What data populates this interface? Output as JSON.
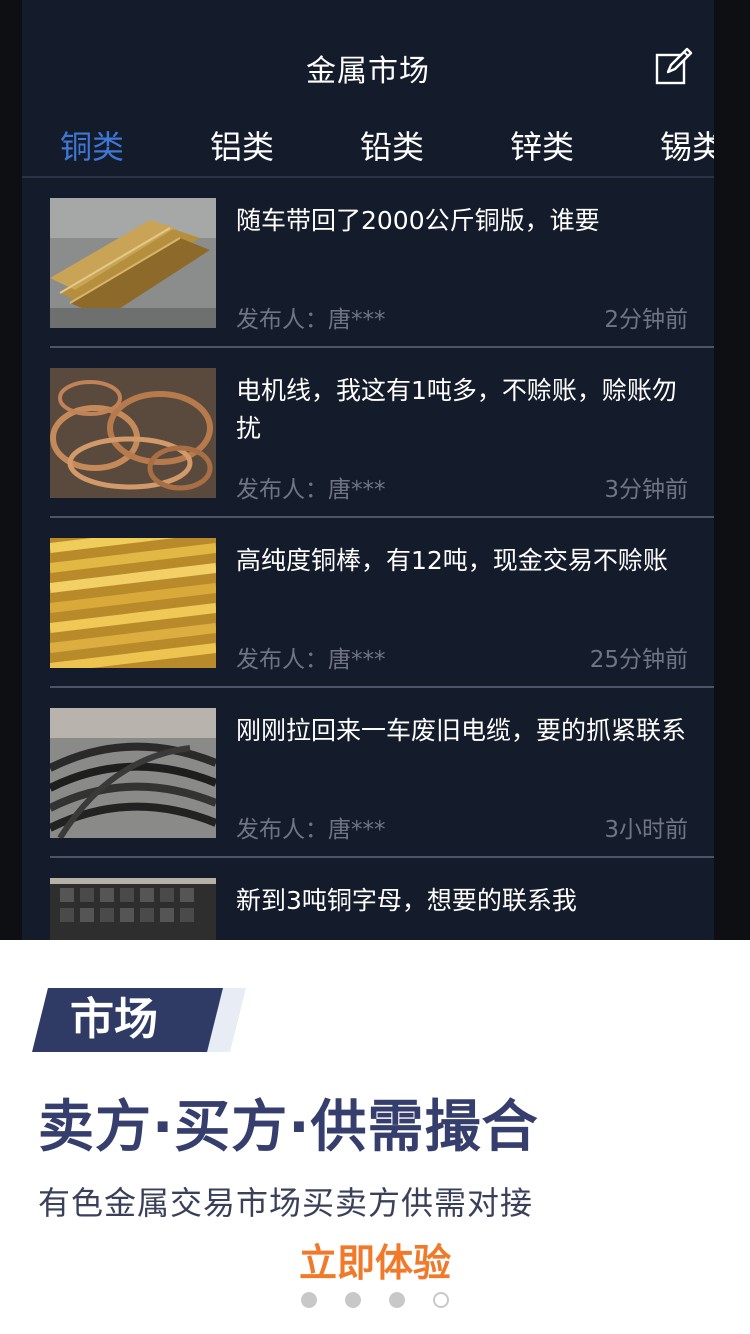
{
  "nav": {
    "title": "金属市场",
    "edit_icon": "edit-icon"
  },
  "tabs": [
    {
      "label": "铜类",
      "active": true
    },
    {
      "label": "铝类",
      "active": false
    },
    {
      "label": "铅类",
      "active": false
    },
    {
      "label": "锌类",
      "active": false
    },
    {
      "label": "锡类",
      "active": false
    }
  ],
  "posts": [
    {
      "title": "随车带回了2000公斤铜版，谁要",
      "publisher": "发布人：唐***",
      "time": "2分钟前",
      "thumb": "copper-plates"
    },
    {
      "title": "电机线，我这有1吨多，不赊账，赊账勿扰",
      "publisher": "发布人：唐***",
      "time": "3分钟前",
      "thumb": "motor-wire"
    },
    {
      "title": "高纯度铜棒，有12吨，现金交易不赊账",
      "publisher": "发布人：唐***",
      "time": "25分钟前",
      "thumb": "copper-rods"
    },
    {
      "title": "刚刚拉回来一车废旧电缆，要的抓紧联系",
      "publisher": "发布人：唐***",
      "time": "3小时前",
      "thumb": "scrap-cable"
    },
    {
      "title": "新到3吨铜字母，想要的联系我",
      "publisher": "",
      "time": "",
      "thumb": "copper-letters"
    }
  ],
  "promo": {
    "badge": "市场",
    "headline": "卖方·买方·供需撮合",
    "subline": "有色金属交易市场买卖方供需对接",
    "cta": "立即体验"
  },
  "pager": {
    "total": 4,
    "active_index": 3
  },
  "colors": {
    "screen_bg": "#141b2b",
    "tab_active": "#3f77d6",
    "headline": "#353e6c",
    "cta": "#f07a2a"
  }
}
